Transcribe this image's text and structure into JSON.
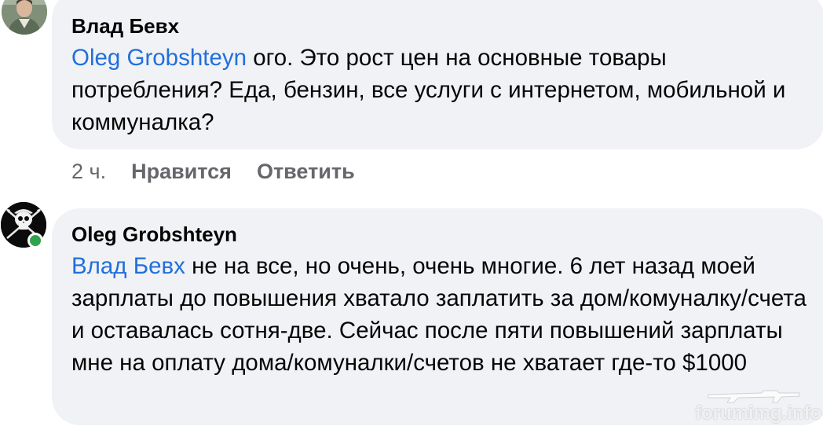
{
  "comments": [
    {
      "author": "Влад Бевх",
      "mention": "Oleg Grobshteyn",
      "text": " ого. Это рост цен на основные товары потребления? Еда, бензин, все услуги с интернетом, мобильной и коммуналка?",
      "avatar_icon": "profile-photo",
      "actions": {
        "time": "2 ч.",
        "like": "Нравится",
        "reply": "Ответить"
      }
    },
    {
      "author": "Oleg Grobshteyn",
      "mention": "Влад Бевх",
      "text": " не на все, но очень,  очень многие. 6 лет назад моей зарплаты до повышения хватало заплатить за дом/комуналку/счета и оставалась сотня-две. Сейчас после пяти повышений зарплаты мне на оплату дома/комуналки/счетов не хватает где-то $1000",
      "avatar_icon": "jolly-roger-icon",
      "online": true
    }
  ],
  "watermark": "forumimg.info",
  "colors": {
    "bubble": "#f0f2f5",
    "mention": "#216fdb",
    "meta": "#65676b",
    "online": "#31a24c"
  }
}
